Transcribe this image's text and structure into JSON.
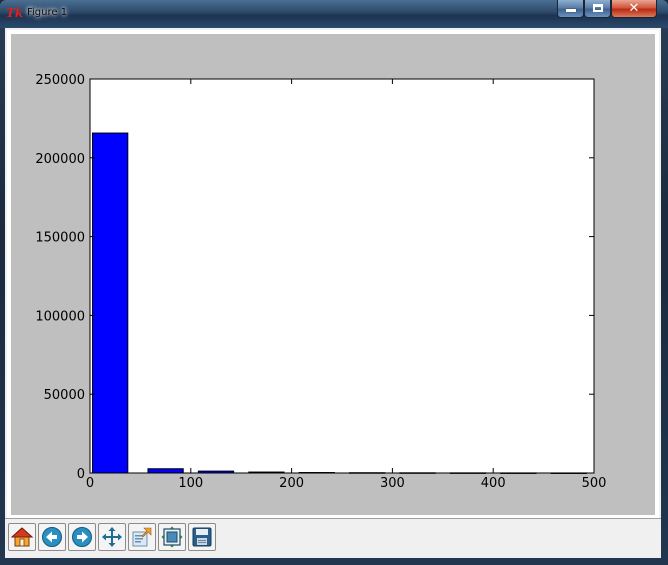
{
  "window": {
    "title": "Figure 1",
    "controls": {
      "minimize": "–",
      "maximize": "□",
      "close": "✕"
    }
  },
  "colors": {
    "figure_bg": "#bfbfbf",
    "axes_bg": "#ffffff",
    "bar_fill": "#0000ff",
    "bar_edge": "#000000"
  },
  "toolbar": {
    "buttons": [
      {
        "name": "home-button",
        "icon": "home-icon"
      },
      {
        "name": "back-button",
        "icon": "back-arrow-icon"
      },
      {
        "name": "forward-button",
        "icon": "forward-arrow-icon"
      },
      {
        "name": "pan-button",
        "icon": "pan-arrows-icon"
      },
      {
        "name": "zoom-button",
        "icon": "zoom-rect-icon"
      },
      {
        "name": "subplots-button",
        "icon": "subplots-config-icon"
      },
      {
        "name": "save-button",
        "icon": "floppy-disk-icon"
      }
    ]
  },
  "chart_data": {
    "type": "bar",
    "x": [
      20,
      75,
      125,
      175,
      225,
      275,
      325,
      375,
      425,
      475
    ],
    "values": [
      215700,
      2700,
      1200,
      600,
      300,
      180,
      120,
      80,
      50,
      30
    ],
    "bar_width": 35,
    "xlim": [
      0,
      500
    ],
    "ylim": [
      0,
      250000
    ],
    "xticks": [
      0,
      100,
      200,
      300,
      400,
      500
    ],
    "yticks": [
      0,
      50000,
      100000,
      150000,
      200000,
      250000
    ],
    "xtick_labels": [
      "0",
      "100",
      "200",
      "300",
      "400",
      "500"
    ],
    "ytick_labels": [
      "0",
      "50000",
      "100000",
      "150000",
      "200000",
      "250000"
    ],
    "title": "",
    "xlabel": "",
    "ylabel": "",
    "grid": false,
    "legend": "none"
  }
}
